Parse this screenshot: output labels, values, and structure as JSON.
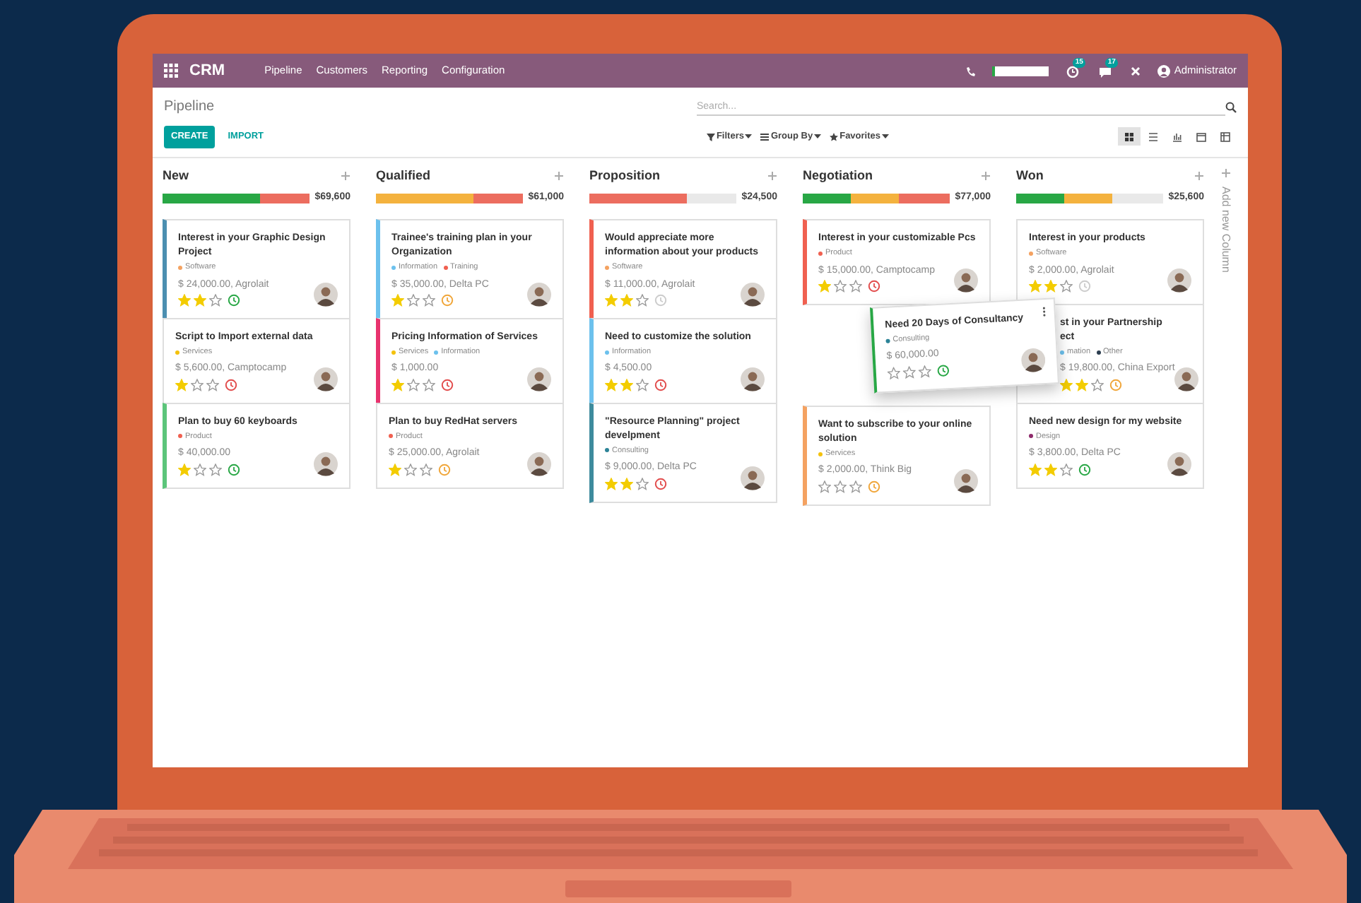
{
  "navbar": {
    "app": "CRM",
    "menu": [
      "Pipeline",
      "Customers",
      "Reporting",
      "Configuration"
    ],
    "badges": [
      {
        "kind": "activity",
        "count": "15"
      },
      {
        "kind": "chat",
        "count": "17"
      }
    ],
    "user": "Administrator"
  },
  "control_panel": {
    "title": "Pipeline",
    "search": {
      "placeholder": "Search..."
    },
    "buttons": [
      {
        "label": "CREATE",
        "kind": "primary"
      },
      {
        "label": "IMPORT",
        "kind": "link"
      }
    ],
    "filters": [
      {
        "label": "Filters",
        "kind": "filter"
      },
      {
        "label": "Group By",
        "kind": "group"
      },
      {
        "label": "Favorites",
        "kind": "star"
      }
    ],
    "views": [
      {
        "kind": "kanban",
        "selected": true
      },
      {
        "kind": "list",
        "selected": false
      },
      {
        "kind": "graph",
        "selected": false
      },
      {
        "kind": "calendar",
        "selected": false
      },
      {
        "kind": "pivot",
        "selected": false
      }
    ]
  },
  "columns": [
    {
      "title": "New",
      "total": "$69,600",
      "bar": [
        {
          "color": "#28a745",
          "level": 0.67
        },
        {
          "color": "#ec6d5f",
          "level": 1
        }
      ],
      "cards": [
        {
          "title": "Interest in your Graphic Design Project",
          "tags": [
            {
              "label": "Software",
              "color": "#f4a261"
            }
          ],
          "amount": "$ 24,000.00, Agrolait",
          "stars": 2,
          "activity": {
            "color": "#28a745"
          },
          "color": "#4c8fb0"
        },
        {
          "title": "Script to Import external data",
          "tags": [
            {
              "label": "Services",
              "color": "#f4c20d"
            }
          ],
          "amount": "$ 5,600.00, Camptocamp",
          "stars": 1,
          "activity": {
            "color": "#e24c4c"
          }
        },
        {
          "title": "Plan to buy 60 keyboards",
          "tags": [
            {
              "label": "Product",
              "color": "#f06050"
            }
          ],
          "amount": "$ 40,000.00",
          "stars": 1,
          "activity": {
            "color": "#28a745"
          },
          "color": "#5cc57a"
        }
      ]
    },
    {
      "title": "Qualified",
      "total": "$61,000",
      "bar": [
        {
          "color": "#f4b23e",
          "level": 0.67
        },
        {
          "color": "#ec6d5f",
          "level": 1
        }
      ],
      "cards": [
        {
          "title": "Trainee's training plan in your Organization",
          "tags": [
            {
              "label": "Information",
              "color": "#6cc1ed"
            },
            {
              "label": "Training",
              "color": "#f06050"
            }
          ],
          "amount": "$ 35,000.00, Delta PC",
          "stars": 1,
          "activity": {
            "color": "#f0a63a"
          },
          "color": "#6cc1ed"
        },
        {
          "title": "Pricing Information of Services",
          "tags": [
            {
              "label": "Services",
              "color": "#f4c20d"
            },
            {
              "label": "Information",
              "color": "#6cc1ed"
            }
          ],
          "amount": "$ 1,000.00",
          "stars": 1,
          "activity": {
            "color": "#e24c4c"
          },
          "color": "#e8336e"
        },
        {
          "title": "Plan to buy RedHat servers",
          "tags": [
            {
              "label": "Product",
              "color": "#f06050"
            }
          ],
          "amount": "$ 25,000.00, Agrolait",
          "stars": 1,
          "activity": {
            "color": "#f0a63a"
          }
        }
      ]
    },
    {
      "title": "Proposition",
      "total": "$24,500",
      "bar": [
        {
          "color": "#ec6d5f",
          "level": 0.67
        }
      ],
      "cards": [
        {
          "title": "Would appreciate more information about your products",
          "tags": [
            {
              "label": "Software",
              "color": "#f4a261"
            }
          ],
          "amount": "$ 11,000.00, Agrolait",
          "stars": 2,
          "activity": {
            "color": "#cccccc"
          },
          "color": "#f06050"
        },
        {
          "title": "Need to customize the solution",
          "tags": [
            {
              "label": "Information",
              "color": "#6cc1ed"
            }
          ],
          "amount": "$ 4,500.00",
          "stars": 2,
          "activity": {
            "color": "#e24c4c"
          },
          "color": "#6cc1ed"
        },
        {
          "title": "\"Resource Planning\" project develpment",
          "tags": [
            {
              "label": "Consulting",
              "color": "#2c8397"
            }
          ],
          "amount": "$ 9,000.00, Delta PC",
          "stars": 2,
          "activity": {
            "color": "#e24c4c"
          },
          "color": "#3d8b9d"
        }
      ]
    },
    {
      "title": "Negotiation",
      "total": "$77,000",
      "bar": [
        {
          "color": "#28a745",
          "level": 0.33
        },
        {
          "color": "#f4b23e",
          "level": 0.66
        },
        {
          "color": "#ec6d5f",
          "level": 1
        }
      ],
      "cards": [
        {
          "title": "Interest in your customizable Pcs",
          "tags": [
            {
              "label": "Product",
              "color": "#f06050"
            }
          ],
          "amount": "$ 15,000.00, Camptocamp",
          "stars": 1,
          "activity": {
            "color": "#e24c4c"
          },
          "color": "#f06050"
        },
        {
          "kind": "gap"
        },
        {
          "title": "Want to subscribe to your online solution",
          "tags": [
            {
              "label": "Services",
              "color": "#f4c20d"
            }
          ],
          "amount": "$ 2,000.00, Think Big",
          "stars": 0,
          "activity": {
            "color": "#f0a63a"
          },
          "color": "#f4a261"
        }
      ]
    },
    {
      "title": "Won",
      "total": "$25,600",
      "bar": [
        {
          "color": "#28a745",
          "level": 0.33
        },
        {
          "color": "#f4b23e",
          "level": 0.66
        }
      ],
      "cards": [
        {
          "title": "Interest in your products",
          "tags": [
            {
              "label": "Software",
              "color": "#f4a261"
            }
          ],
          "amount": "$ 2,000.00, Agrolait",
          "stars": 2,
          "activity": {
            "color": "#cccccc"
          }
        },
        {
          "kind": "covered",
          "title_lines": [
            "st in your Partnership",
            "ect"
          ],
          "tags": [
            {
              "label": "mation",
              "color": "#6cc1ed"
            },
            {
              "label": "Other",
              "color": "#2c3e50"
            }
          ],
          "amount": "$ 19,800.00, China Export",
          "stars": 2,
          "activity": {
            "color": "#f0a63a"
          }
        },
        {
          "title": "Need new design for my website",
          "tags": [
            {
              "label": "Design",
              "color": "#8e2a6b"
            }
          ],
          "amount": "$ 3,800.00, Delta PC",
          "stars": 2,
          "activity": {
            "color": "#28a745"
          }
        }
      ]
    }
  ],
  "dragged_card": {
    "title": "Need 20 Days of Consultancy",
    "tags": [
      {
        "label": "Consulting",
        "color": "#2c8397"
      }
    ],
    "amount": "$ 60,000.00",
    "stars": 0,
    "activity": {
      "color": "#28a745"
    },
    "color": "#28a745"
  },
  "add_column": "Add new Column"
}
